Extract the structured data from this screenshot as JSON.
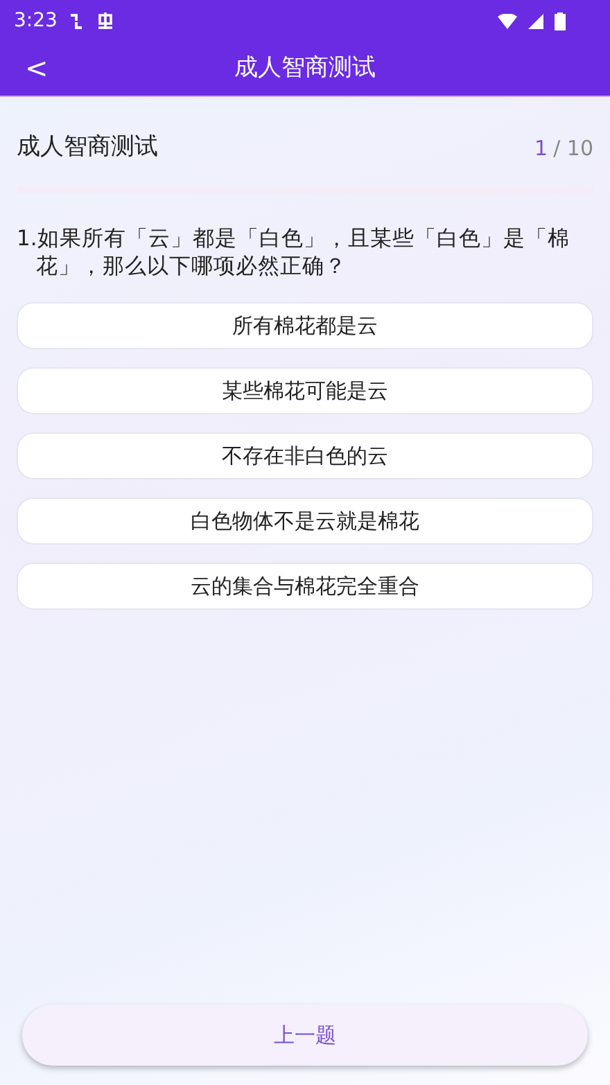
{
  "status_bar": {
    "time": "3:23"
  },
  "app_bar": {
    "back": "<",
    "title": "成人智商测试"
  },
  "quiz": {
    "title": "成人智商测试",
    "current": "1",
    "total": "/ 10",
    "level": 0
  },
  "question": "1.如果所有「云」都是「白色」，且某些「白色」是「棉花」，那么以下哪项必然正确？",
  "options": [
    {
      "label": "所有棉花都是云",
      "selected": false
    },
    {
      "label": "某些棉花可能是云",
      "selected": false
    },
    {
      "label": "不存在非白色的云",
      "selected": false
    },
    {
      "label": "白色物体不是云就是棉花",
      "selected": false
    },
    {
      "label": "云的集合与棉花完全重合",
      "selected": false
    }
  ],
  "prev_button": "上一题"
}
